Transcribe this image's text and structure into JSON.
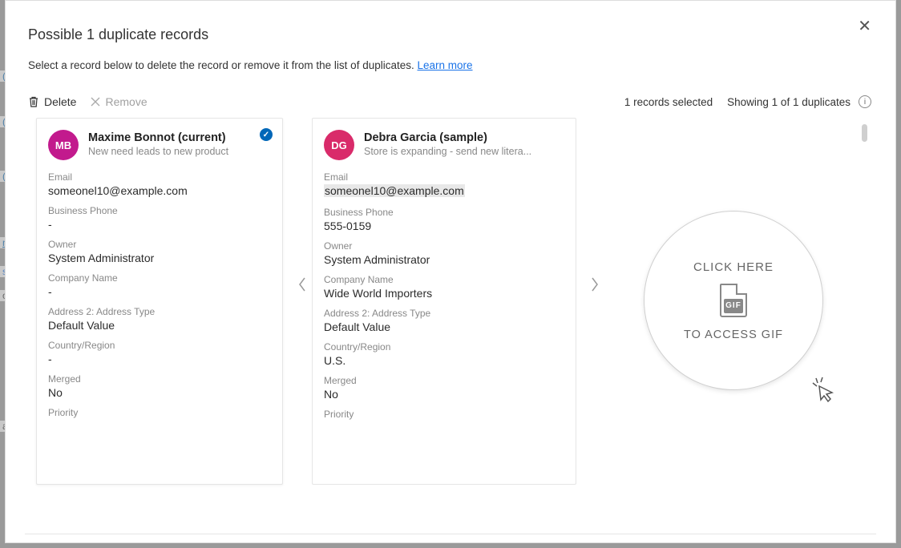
{
  "dialog": {
    "title": "Possible 1 duplicate records",
    "subtitle_prefix": "Select a record below to delete the record or remove it from the list of duplicates. ",
    "learn_more": "Learn more"
  },
  "toolbar": {
    "delete_label": "Delete",
    "remove_label": "Remove",
    "selected_count_text": "1 records selected",
    "showing_text": "Showing 1 of 1 duplicates"
  },
  "cards": [
    {
      "initials": "MB",
      "name": "Maxime Bonnot (current)",
      "subtitle": "New need leads to new product",
      "selected": true,
      "fields": {
        "email": {
          "label": "Email",
          "value": "someonel10@example.com",
          "highlighted": false
        },
        "phone": {
          "label": "Business Phone",
          "value": "-"
        },
        "owner": {
          "label": "Owner",
          "value": "System Administrator"
        },
        "company": {
          "label": "Company Name",
          "value": "-"
        },
        "addr2type": {
          "label": "Address 2: Address Type",
          "value": "Default Value"
        },
        "country": {
          "label": "Country/Region",
          "value": "-"
        },
        "merged": {
          "label": "Merged",
          "value": "No"
        },
        "priority": {
          "label": "Priority",
          "value": ""
        }
      }
    },
    {
      "initials": "DG",
      "name": "Debra Garcia (sample)",
      "subtitle": "Store is expanding - send new litera...",
      "selected": false,
      "fields": {
        "email": {
          "label": "Email",
          "value": "someonel10@example.com",
          "highlighted": true
        },
        "phone": {
          "label": "Business Phone",
          "value": "555-0159"
        },
        "owner": {
          "label": "Owner",
          "value": "System Administrator"
        },
        "company": {
          "label": "Company Name",
          "value": "Wide World Importers"
        },
        "addr2type": {
          "label": "Address 2: Address Type",
          "value": "Default Value"
        },
        "country": {
          "label": "Country/Region",
          "value": "U.S."
        },
        "merged": {
          "label": "Merged",
          "value": "No"
        },
        "priority": {
          "label": "Priority",
          "value": ""
        }
      }
    }
  ],
  "gif_badge": {
    "line1": "CLICK HERE",
    "icon_label": "GIF",
    "line2": "TO ACCESS GIF"
  }
}
